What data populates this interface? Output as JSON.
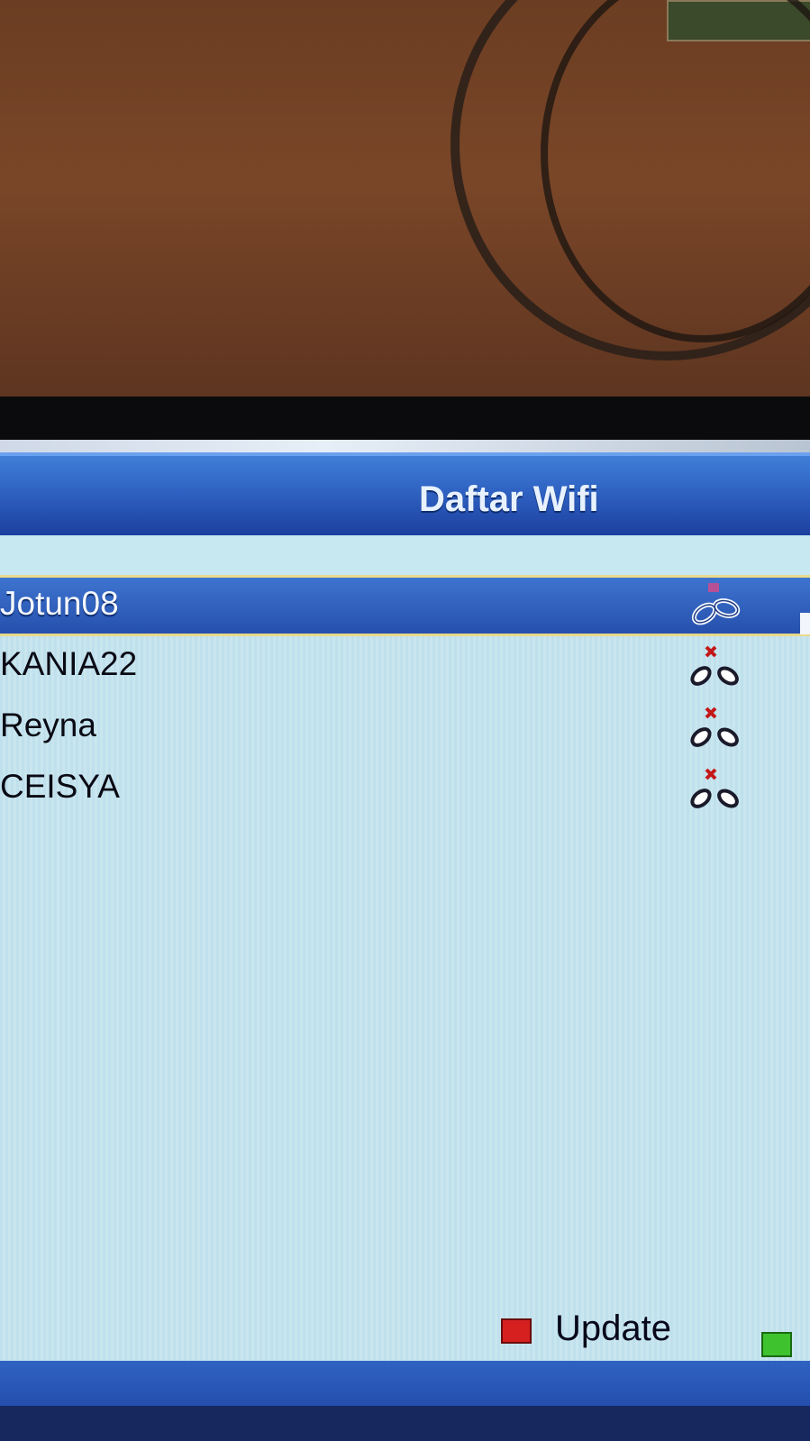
{
  "screen": {
    "title": "Daftar Wifi"
  },
  "networks": [
    {
      "ssid": "Jotun08",
      "status_icon": "connected-link-icon",
      "selected": true
    },
    {
      "ssid": "KANIA22",
      "status_icon": "disconnected-link-icon",
      "selected": false
    },
    {
      "ssid": "Reyna",
      "status_icon": "disconnected-link-icon",
      "selected": false
    },
    {
      "ssid": "CEISYA",
      "status_icon": "disconnected-link-icon",
      "selected": false
    }
  ],
  "footer": {
    "red_key_label": "Update",
    "red_key_color": "#d62020",
    "green_key_color": "#3ec22e"
  },
  "colors": {
    "title_bar": "#2f62c2",
    "selection": "#2650ad",
    "list_background": "#c4e4ee",
    "selection_border": "#e9d98a"
  }
}
